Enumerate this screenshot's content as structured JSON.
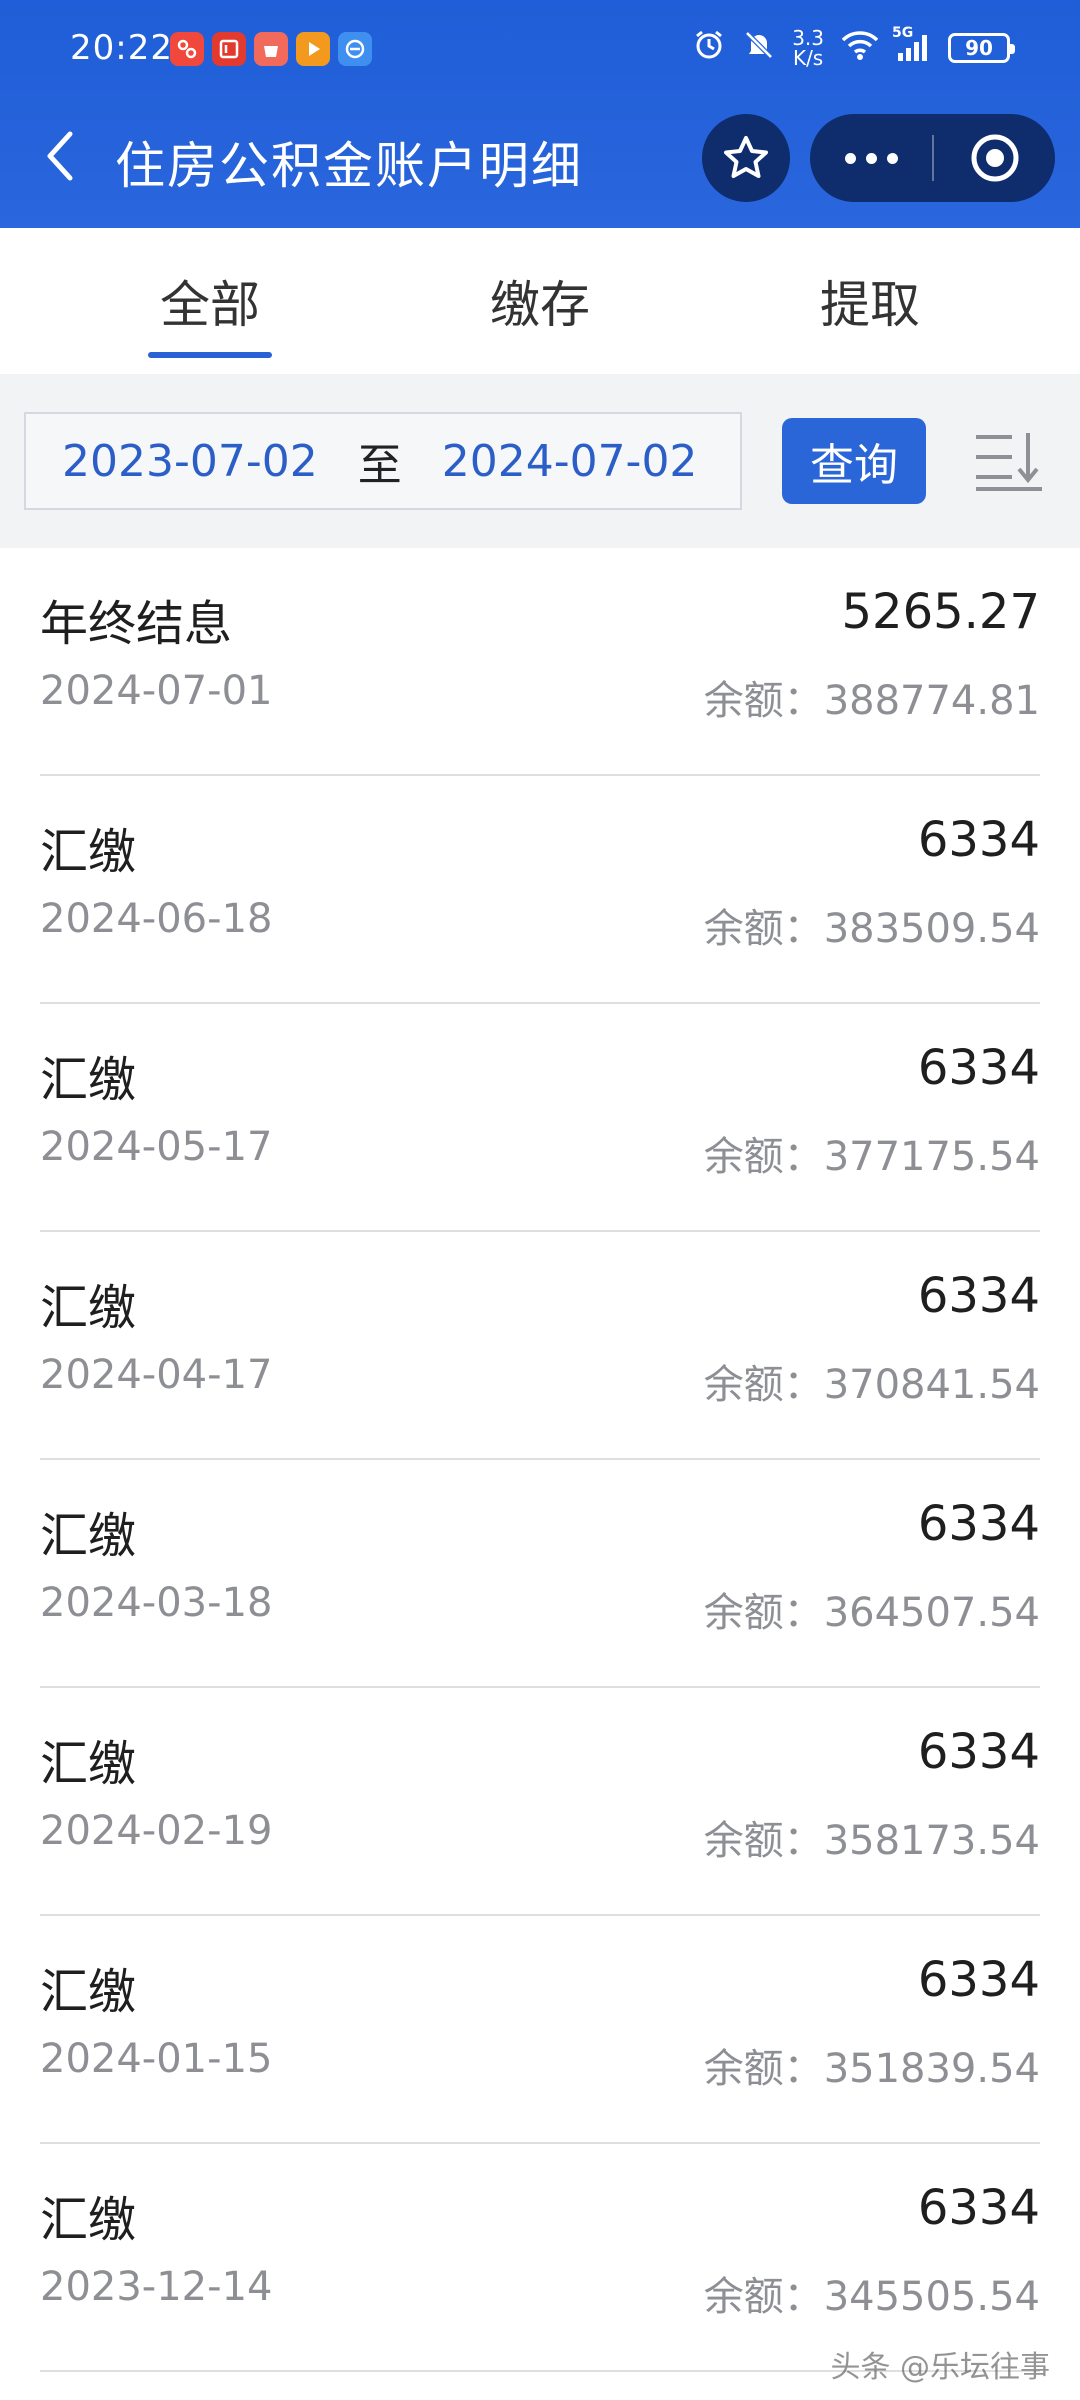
{
  "status_bar": {
    "time": "20:22",
    "net_speed_value": "3.3",
    "net_speed_unit": "K/s",
    "signal_label": "5G",
    "battery": "90"
  },
  "header": {
    "title": "住房公积金账户明细"
  },
  "tabs": [
    {
      "label": "全部",
      "active": true
    },
    {
      "label": "缴存",
      "active": false
    },
    {
      "label": "提取",
      "active": false
    }
  ],
  "filter": {
    "start_date": "2023-07-02",
    "separator": "至",
    "end_date": "2024-07-02",
    "query_label": "查询"
  },
  "balance_label": "余额：",
  "transactions": [
    {
      "title": "年终结息",
      "amount": "5265.27",
      "date": "2024-07-01",
      "balance": "388774.81"
    },
    {
      "title": "汇缴",
      "amount": "6334",
      "date": "2024-06-18",
      "balance": "383509.54"
    },
    {
      "title": "汇缴",
      "amount": "6334",
      "date": "2024-05-17",
      "balance": "377175.54"
    },
    {
      "title": "汇缴",
      "amount": "6334",
      "date": "2024-04-17",
      "balance": "370841.54"
    },
    {
      "title": "汇缴",
      "amount": "6334",
      "date": "2024-03-18",
      "balance": "364507.54"
    },
    {
      "title": "汇缴",
      "amount": "6334",
      "date": "2024-02-19",
      "balance": "358173.54"
    },
    {
      "title": "汇缴",
      "amount": "6334",
      "date": "2024-01-15",
      "balance": "351839.54"
    },
    {
      "title": "汇缴",
      "amount": "6334",
      "date": "2023-12-14",
      "balance": "345505.54"
    }
  ],
  "watermark": "头条 @乐坛往事",
  "colors": {
    "header_blue": "#2a66dd",
    "accent_blue": "#2b66d9",
    "capsule_dark": "#0f2c6c"
  }
}
